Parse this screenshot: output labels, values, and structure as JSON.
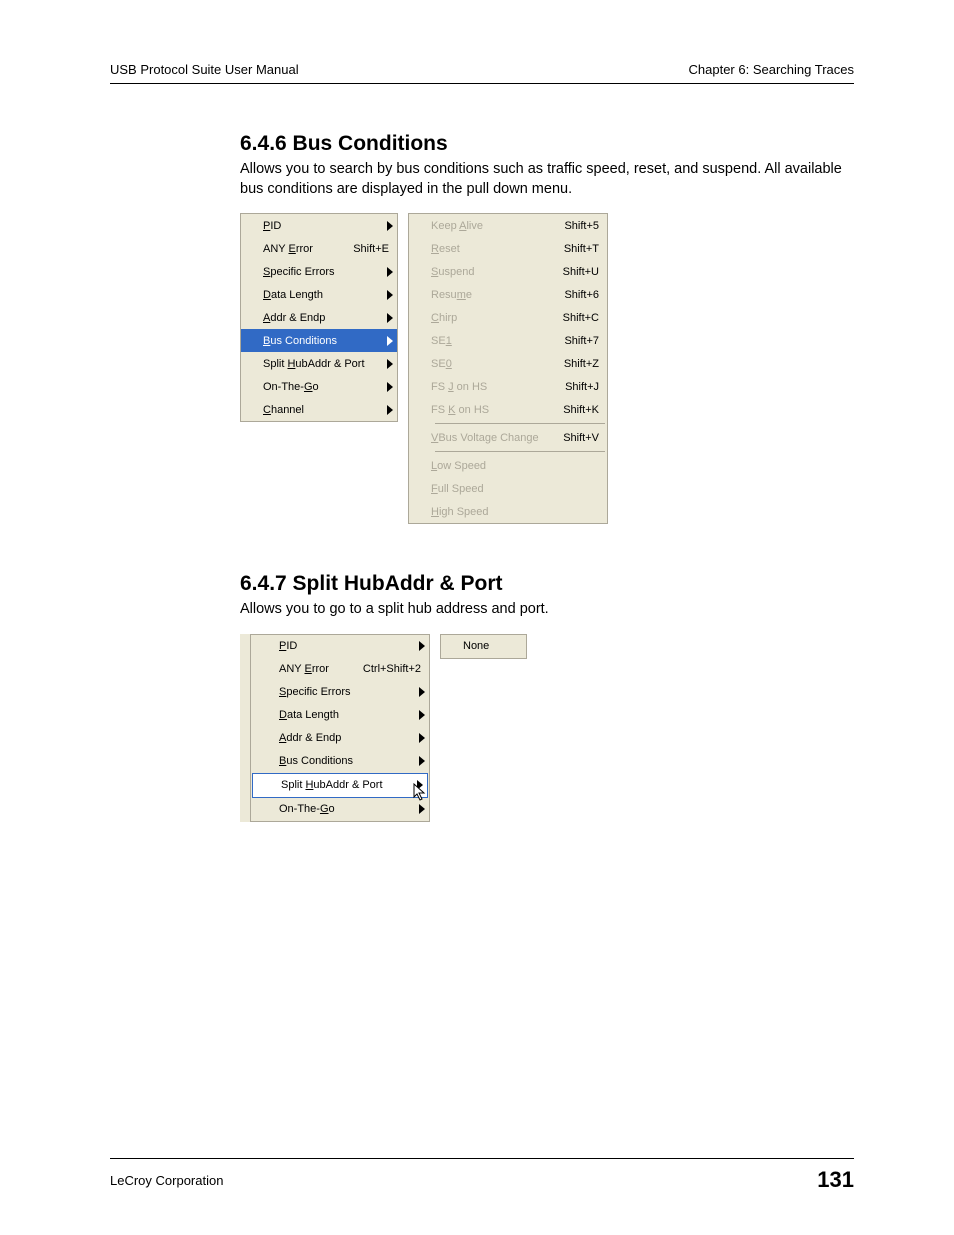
{
  "header": {
    "left": "USB Protocol Suite User Manual",
    "right": "Chapter 6: Searching Traces"
  },
  "section1": {
    "heading": "6.4.6 Bus Conditions",
    "desc": "Allows you to search by bus conditions such as traffic speed, reset, and suspend. All available bus conditions are displayed in the pull down menu.",
    "menuA": {
      "items": [
        {
          "pre": "",
          "u": "P",
          "post": "ID",
          "shortcut": "",
          "arrow": true
        },
        {
          "pre": "ANY ",
          "u": "E",
          "post": "rror",
          "shortcut": "Shift+E",
          "arrow": false
        },
        {
          "pre": "",
          "u": "S",
          "post": "pecific Errors",
          "shortcut": "",
          "arrow": true
        },
        {
          "pre": "",
          "u": "D",
          "post": "ata Length",
          "shortcut": "",
          "arrow": true
        },
        {
          "pre": "",
          "u": "A",
          "post": "ddr & Endp",
          "shortcut": "",
          "arrow": true
        },
        {
          "pre": "",
          "u": "B",
          "post": "us Conditions",
          "shortcut": "",
          "arrow": true,
          "highlight": true
        },
        {
          "pre": "Split ",
          "u": "H",
          "post": "ubAddr & Port",
          "shortcut": "",
          "arrow": true
        },
        {
          "pre": "On-The-",
          "u": "G",
          "post": "o",
          "shortcut": "",
          "arrow": true
        },
        {
          "pre": "",
          "u": "C",
          "post": "hannel",
          "shortcut": "",
          "arrow": true
        }
      ]
    },
    "menuB": {
      "items": [
        {
          "pre": "Keep ",
          "u": "A",
          "post": "live",
          "shortcut": "Shift+5"
        },
        {
          "pre": "",
          "u": "R",
          "post": "eset",
          "shortcut": "Shift+T"
        },
        {
          "pre": "",
          "u": "S",
          "post": "uspend",
          "shortcut": "Shift+U"
        },
        {
          "pre": "Resu",
          "u": "m",
          "post": "e",
          "shortcut": "Shift+6"
        },
        {
          "pre": "",
          "u": "C",
          "post": "hirp",
          "shortcut": "Shift+C"
        },
        {
          "pre": "SE",
          "u": "1",
          "post": "",
          "shortcut": "Shift+7"
        },
        {
          "pre": "SE",
          "u": "0",
          "post": "",
          "shortcut": "Shift+Z"
        },
        {
          "pre": "FS ",
          "u": "J",
          "post": " on HS",
          "shortcut": "Shift+J"
        },
        {
          "pre": "FS ",
          "u": "K",
          "post": " on HS",
          "shortcut": "Shift+K"
        },
        {
          "sep": true
        },
        {
          "pre": "",
          "u": "V",
          "post": "Bus Voltage Change",
          "shortcut": "Shift+V"
        },
        {
          "sep": true
        },
        {
          "pre": "",
          "u": "L",
          "post": "ow Speed",
          "shortcut": ""
        },
        {
          "pre": "",
          "u": "F",
          "post": "ull Speed",
          "shortcut": ""
        },
        {
          "pre": "",
          "u": "H",
          "post": "igh Speed",
          "shortcut": ""
        }
      ]
    }
  },
  "section2": {
    "heading": "6.4.7 Split HubAddr & Port",
    "desc": "Allows you to go to a split hub address and port.",
    "menuA": {
      "items": [
        {
          "pre": "",
          "u": "P",
          "post": "ID",
          "shortcut": "",
          "arrow": true
        },
        {
          "pre": "ANY ",
          "u": "E",
          "post": "rror",
          "shortcut": "Ctrl+Shift+2",
          "arrow": false
        },
        {
          "pre": "",
          "u": "S",
          "post": "pecific Errors",
          "shortcut": "",
          "arrow": true
        },
        {
          "pre": "",
          "u": "D",
          "post": "ata Length",
          "shortcut": "",
          "arrow": true
        },
        {
          "pre": "",
          "u": "A",
          "post": "ddr & Endp",
          "shortcut": "",
          "arrow": true
        },
        {
          "pre": "",
          "u": "B",
          "post": "us Conditions",
          "shortcut": "",
          "arrow": true
        },
        {
          "pre": "Split ",
          "u": "H",
          "post": "ubAddr & Port",
          "shortcut": "",
          "arrow": true,
          "selected": true
        },
        {
          "pre": "On-The-",
          "u": "G",
          "post": "o",
          "shortcut": "",
          "arrow": true
        }
      ]
    },
    "submenu": {
      "label": "None"
    }
  },
  "footer": {
    "left": "LeCroy Corporation",
    "page": "131"
  }
}
